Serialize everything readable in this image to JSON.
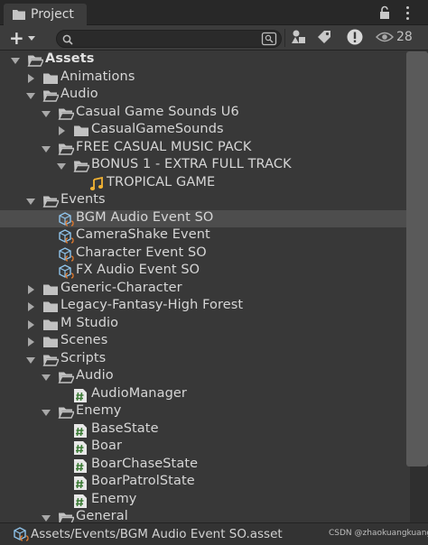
{
  "window": {
    "tab_label": "Project",
    "hidden_count": "28"
  },
  "toolbar": {
    "create_symbol": "+",
    "search_placeholder": "",
    "search_value": ""
  },
  "tree": [
    {
      "label": "Assets",
      "depth": 0,
      "expand": "down",
      "icon": "folder-open-icon",
      "bold": true
    },
    {
      "label": "Animations",
      "depth": 1,
      "expand": "right",
      "icon": "folder-icon"
    },
    {
      "label": "Audio",
      "depth": 1,
      "expand": "down",
      "icon": "folder-open-icon"
    },
    {
      "label": "Casual Game Sounds U6",
      "depth": 2,
      "expand": "down",
      "icon": "folder-open-icon"
    },
    {
      "label": "CasualGameSounds",
      "depth": 3,
      "expand": "right",
      "icon": "folder-icon"
    },
    {
      "label": "FREE CASUAL MUSIC PACK",
      "depth": 2,
      "expand": "down",
      "icon": "folder-open-icon"
    },
    {
      "label": "BONUS 1 - EXTRA FULL TRACK",
      "depth": 3,
      "expand": "down",
      "icon": "folder-open-icon"
    },
    {
      "label": "TROPICAL GAME",
      "depth": 4,
      "expand": "none",
      "icon": "audio-clip-icon"
    },
    {
      "label": "Events",
      "depth": 1,
      "expand": "down",
      "icon": "folder-open-icon"
    },
    {
      "label": "BGM Audio Event SO",
      "depth": 2,
      "expand": "none",
      "icon": "scriptable-object-icon",
      "selected": true
    },
    {
      "label": "CameraShake Event",
      "depth": 2,
      "expand": "none",
      "icon": "scriptable-object-icon"
    },
    {
      "label": "Character Event SO",
      "depth": 2,
      "expand": "none",
      "icon": "scriptable-object-icon"
    },
    {
      "label": "FX Audio Event SO",
      "depth": 2,
      "expand": "none",
      "icon": "scriptable-object-icon"
    },
    {
      "label": "Generic-Character",
      "depth": 1,
      "expand": "right",
      "icon": "folder-icon"
    },
    {
      "label": "Legacy-Fantasy-High Forest",
      "depth": 1,
      "expand": "right",
      "icon": "folder-icon"
    },
    {
      "label": "M Studio",
      "depth": 1,
      "expand": "right",
      "icon": "folder-icon"
    },
    {
      "label": "Scenes",
      "depth": 1,
      "expand": "right",
      "icon": "folder-icon"
    },
    {
      "label": "Scripts",
      "depth": 1,
      "expand": "down",
      "icon": "folder-open-icon"
    },
    {
      "label": "Audio",
      "depth": 2,
      "expand": "down",
      "icon": "folder-open-icon"
    },
    {
      "label": "AudioManager",
      "depth": 3,
      "expand": "none",
      "icon": "csharp-script-icon"
    },
    {
      "label": "Enemy",
      "depth": 2,
      "expand": "down",
      "icon": "folder-open-icon"
    },
    {
      "label": "BaseState",
      "depth": 3,
      "expand": "none",
      "icon": "csharp-script-icon"
    },
    {
      "label": "Boar",
      "depth": 3,
      "expand": "none",
      "icon": "csharp-script-icon"
    },
    {
      "label": "BoarChaseState",
      "depth": 3,
      "expand": "none",
      "icon": "csharp-script-icon"
    },
    {
      "label": "BoarPatrolState",
      "depth": 3,
      "expand": "none",
      "icon": "csharp-script-icon"
    },
    {
      "label": "Enemy",
      "depth": 3,
      "expand": "none",
      "icon": "csharp-script-icon"
    },
    {
      "label": "General",
      "depth": 2,
      "expand": "down",
      "icon": "folder-open-icon"
    }
  ],
  "footer": {
    "path": "Assets/Events/BGM Audio Event SO.asset",
    "icon": "scriptable-object-icon"
  },
  "watermark": "CSDN @zhaokuangkuang..."
}
